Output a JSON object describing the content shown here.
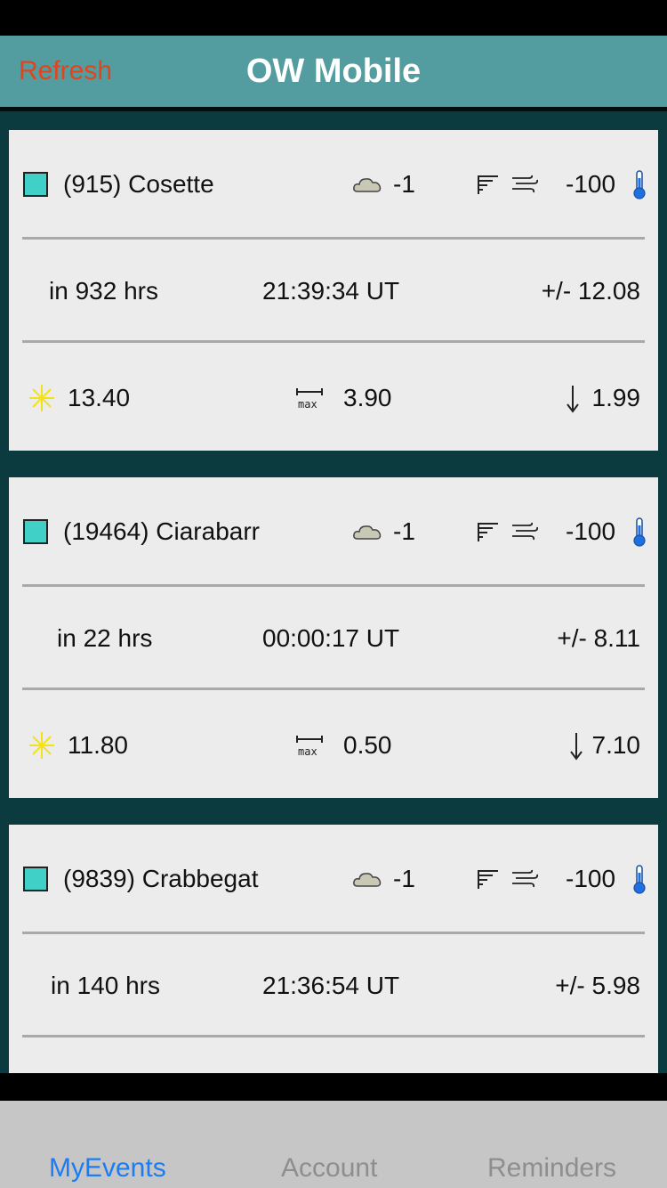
{
  "header": {
    "refresh_label": "Refresh",
    "title": "OW Mobile"
  },
  "events": [
    {
      "name": "(915) Cosette",
      "cloud": "-1",
      "temp": "-100",
      "in_hrs": "in 932 hrs",
      "time": "21:39:34 UT",
      "error": "+/- 12.08",
      "mag": "13.40",
      "max_duration": "3.90",
      "drop": "1.99"
    },
    {
      "name": "(19464) Ciarabarr",
      "cloud": "-1",
      "temp": "-100",
      "in_hrs": "in 22 hrs",
      "time": "00:00:17 UT",
      "error": "+/- 8.11",
      "mag": "11.80",
      "max_duration": "0.50",
      "drop": "7.10"
    },
    {
      "name": "(9839) Crabbegat",
      "cloud": "-1",
      "temp": "-100",
      "in_hrs": "in 140 hrs",
      "time": "21:36:54 UT",
      "error": "+/- 5.98"
    }
  ],
  "icons": {
    "cloud": "cloud-icon",
    "wind_strength": "wind-strength-icon",
    "wind": "wind-icon",
    "thermometer": "thermometer-icon",
    "star": "star-icon",
    "max_duration": "max-duration-icon",
    "drop": "down-arrow-icon"
  },
  "colors": {
    "nav_bg": "#539c9f",
    "list_bg": "#0b3a3f",
    "refresh": "#e0451e",
    "tab_active": "#1c7cf4",
    "swatch": "#40d0c8"
  },
  "tabs": [
    {
      "label": "MyEvents",
      "active": true
    },
    {
      "label": "Account",
      "active": false
    },
    {
      "label": "Reminders",
      "active": false
    }
  ]
}
